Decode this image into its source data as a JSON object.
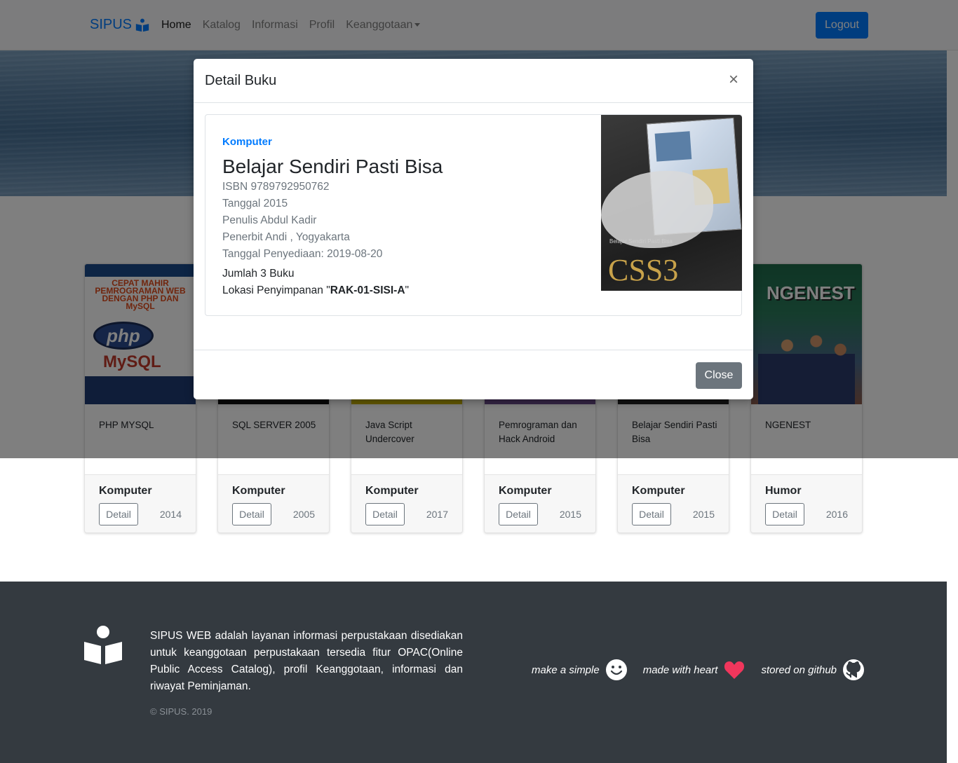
{
  "navbar": {
    "brand": "SIPUS",
    "items": [
      {
        "label": "Home",
        "active": true
      },
      {
        "label": "Katalog"
      },
      {
        "label": "Informasi"
      },
      {
        "label": "Profil"
      },
      {
        "label": "Keanggotaan"
      }
    ],
    "logout": "Logout"
  },
  "books": [
    {
      "title": "PHP MYSQL",
      "category": "Komputer",
      "year": "2014",
      "detail": "Detail"
    },
    {
      "title": "SQL SERVER 2005",
      "category": "Komputer",
      "year": "2005",
      "detail": "Detail"
    },
    {
      "title": "Java Script Undercover",
      "category": "Komputer",
      "year": "2017",
      "detail": "Detail"
    },
    {
      "title": "Pemrograman dan Hack Android",
      "category": "Komputer",
      "year": "2015",
      "detail": "Detail"
    },
    {
      "title": "Belajar Sendiri Pasti Bisa",
      "category": "Komputer",
      "year": "2015",
      "detail": "Detail"
    },
    {
      "title": "NGENEST",
      "category": "Humor",
      "year": "2016",
      "detail": "Detail"
    }
  ],
  "covers": {
    "php": {
      "header": "CEPAT MAHIR PEMROGRAMAN WEB DENGAN PHP DAN MySQL",
      "php": "php",
      "mysql": "MySQL"
    },
    "ngenest": {
      "title": "NGENEST"
    },
    "css3": {
      "text": "CSS3",
      "sub": "Belajar Sendiri Pasti Bisa"
    }
  },
  "modal": {
    "title": "Detail Buku",
    "close_x": "×",
    "category": "Komputer",
    "book_title": "Belajar Sendiri Pasti Bisa",
    "isbn": "ISBN 9789792950762",
    "date": "Tanggal 2015",
    "author": "Penulis Abdul Kadir",
    "publisher": "Penerbit Andi , Yogyakarta",
    "provided": "Tanggal Penyediaan: 2019-08-20",
    "count": "Jumlah 3 Buku",
    "location_prefix": "Lokasi Penyimpanan \"",
    "location_code": "RAK-01-SISI-A",
    "location_suffix": "\"",
    "close_button": "Close"
  },
  "footer": {
    "text": "SIPUS WEB adalah layanan informasi perpustakaan disediakan untuk keanggotaan perpustakaan tersedia fitur OPAC(Online Public Access Catalog), profil Keanggotaan, informasi dan riwayat Peminjaman.",
    "copyright": "© SIPUS. 2019",
    "links": [
      {
        "label": "make a simple",
        "icon": "smile-icon"
      },
      {
        "label": "made with heart",
        "icon": "heart-icon"
      },
      {
        "label": "stored on github",
        "icon": "github-icon"
      }
    ]
  },
  "colors": {
    "primary": "#007bff",
    "secondary": "#6c757d",
    "footer": "#343a40",
    "heart": "#f0365c"
  }
}
